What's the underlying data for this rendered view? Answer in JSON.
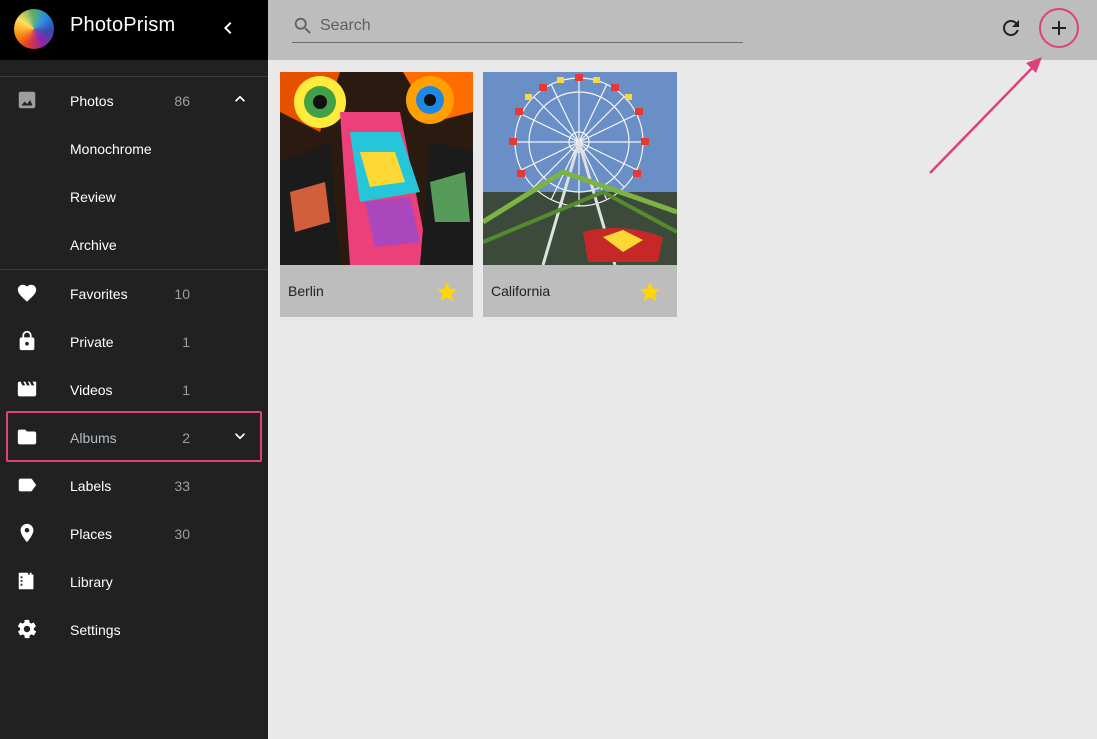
{
  "app": {
    "title": "PhotoPrism"
  },
  "sidebar": {
    "items": [
      {
        "label": "Photos",
        "count": "86",
        "icon": "image-icon"
      },
      {
        "label": "Monochrome"
      },
      {
        "label": "Review"
      },
      {
        "label": "Archive"
      },
      {
        "label": "Favorites",
        "count": "10",
        "icon": "heart-icon"
      },
      {
        "label": "Private",
        "count": "1",
        "icon": "lock-icon"
      },
      {
        "label": "Videos",
        "count": "1",
        "icon": "movie-icon"
      },
      {
        "label": "Albums",
        "count": "2",
        "icon": "folder-icon"
      },
      {
        "label": "Labels",
        "count": "33",
        "icon": "label-icon"
      },
      {
        "label": "Places",
        "count": "30",
        "icon": "place-icon"
      },
      {
        "label": "Library",
        "icon": "library-icon"
      },
      {
        "label": "Settings",
        "icon": "settings-icon"
      }
    ]
  },
  "toolbar": {
    "search_placeholder": "Search"
  },
  "albums": [
    {
      "title": "Berlin",
      "favorite": true
    },
    {
      "title": "California",
      "favorite": true
    }
  ],
  "colors": {
    "sidebar_bg": "#212121",
    "toolbar_bg": "#bdbdbd",
    "content_bg": "#e9e9e9",
    "highlight": "#e0407b",
    "star": "#ffd600"
  }
}
